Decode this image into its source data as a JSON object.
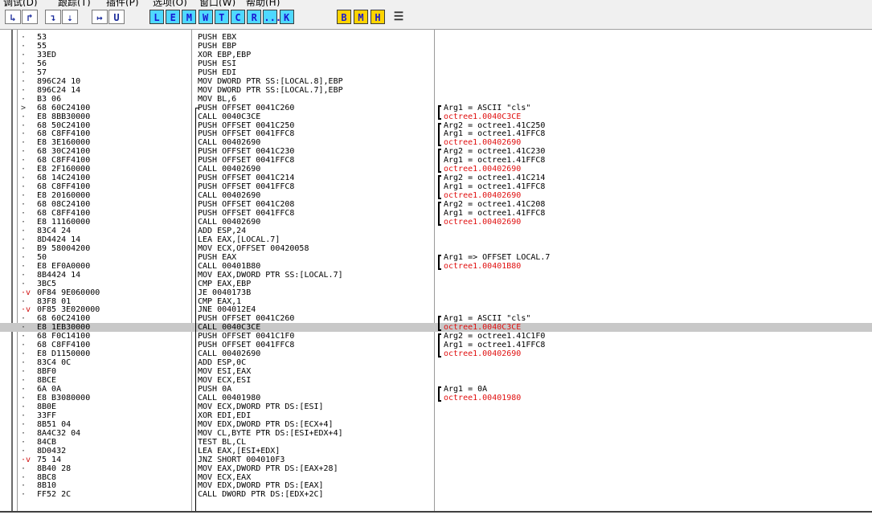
{
  "menubar": {
    "items": [
      "调试(D)",
      "跟踪(T)",
      "插件(P)",
      "选项(O)",
      "窗口(W)",
      "帮助(H)"
    ]
  },
  "toolbar": {
    "step_buttons": [
      "step-into",
      "step-over",
      "trace-into",
      "trace-over",
      "execute-till-return",
      "execute-till-user-code"
    ],
    "step_glyphs": [
      "↳",
      "↱",
      "↴",
      "⇣",
      "↦",
      "U"
    ],
    "window_buttons": [
      "L",
      "E",
      "M",
      "W",
      "T",
      "C",
      "R",
      "...",
      "K"
    ],
    "bp_buttons": [
      "B",
      "M",
      "H"
    ],
    "list_icon": "list-icon",
    "accent_cyan": "#4fd8ff",
    "accent_yellow": "#ffd400"
  },
  "cpu": {
    "rows": [
      {
        "mark": "·",
        "hex": "53",
        "dis": "PUSH EBX",
        "cmt": ""
      },
      {
        "mark": "·",
        "hex": "55",
        "dis": "PUSH EBP",
        "cmt": ""
      },
      {
        "mark": "·",
        "hex": "33ED",
        "dis": "XOR EBP,EBP",
        "cmt": ""
      },
      {
        "mark": "·",
        "hex": "56",
        "dis": "PUSH ESI",
        "cmt": ""
      },
      {
        "mark": "·",
        "hex": "57",
        "dis": "PUSH EDI",
        "cmt": ""
      },
      {
        "mark": "·",
        "hex": "896C24 10",
        "dis": "MOV DWORD PTR SS:[LOCAL.8],EBP",
        "cmt": ""
      },
      {
        "mark": "·",
        "hex": "896C24 14",
        "dis": "MOV DWORD PTR SS:[LOCAL.7],EBP",
        "cmt": ""
      },
      {
        "mark": "·",
        "hex": "B3 06",
        "dis": "MOV BL,6",
        "cmt": ""
      },
      {
        "mark": ">",
        "hex": "68 60C24100",
        "dis": "PUSH OFFSET 0041C260",
        "cmt": "Arg1 = ASCII \"cls\""
      },
      {
        "mark": "·",
        "hex": "E8 8BB30000",
        "dis": "CALL 0040C3CE",
        "cmt": "octree1.0040C3CE",
        "red": true
      },
      {
        "mark": "·",
        "hex": "68 50C24100",
        "dis": "PUSH OFFSET 0041C250",
        "cmt": "Arg2 = octree1.41C250"
      },
      {
        "mark": "·",
        "hex": "68 C8FF4100",
        "dis": "PUSH OFFSET 0041FFC8",
        "cmt": "Arg1 = octree1.41FFC8"
      },
      {
        "mark": "·",
        "hex": "E8 3E160000",
        "dis": "CALL 00402690",
        "cmt": "octree1.00402690",
        "red": true
      },
      {
        "mark": "·",
        "hex": "68 30C24100",
        "dis": "PUSH OFFSET 0041C230",
        "cmt": "Arg2 = octree1.41C230"
      },
      {
        "mark": "·",
        "hex": "68 C8FF4100",
        "dis": "PUSH OFFSET 0041FFC8",
        "cmt": "Arg1 = octree1.41FFC8"
      },
      {
        "mark": "·",
        "hex": "E8 2F160000",
        "dis": "CALL 00402690",
        "cmt": "octree1.00402690",
        "red": true
      },
      {
        "mark": "·",
        "hex": "68 14C24100",
        "dis": "PUSH OFFSET 0041C214",
        "cmt": "Arg2 = octree1.41C214"
      },
      {
        "mark": "·",
        "hex": "68 C8FF4100",
        "dis": "PUSH OFFSET 0041FFC8",
        "cmt": "Arg1 = octree1.41FFC8"
      },
      {
        "mark": "·",
        "hex": "E8 20160000",
        "dis": "CALL 00402690",
        "cmt": "octree1.00402690",
        "red": true
      },
      {
        "mark": "·",
        "hex": "68 08C24100",
        "dis": "PUSH OFFSET 0041C208",
        "cmt": "Arg2 = octree1.41C208"
      },
      {
        "mark": "·",
        "hex": "68 C8FF4100",
        "dis": "PUSH OFFSET 0041FFC8",
        "cmt": "Arg1 = octree1.41FFC8"
      },
      {
        "mark": "·",
        "hex": "E8 11160000",
        "dis": "CALL 00402690",
        "cmt": "octree1.00402690",
        "red": true
      },
      {
        "mark": "·",
        "hex": "83C4 24",
        "dis": "ADD ESP,24",
        "cmt": ""
      },
      {
        "mark": "·",
        "hex": "8D4424 14",
        "dis": "LEA EAX,[LOCAL.7]",
        "cmt": ""
      },
      {
        "mark": "·",
        "hex": "B9 58004200",
        "dis": "MOV ECX,OFFSET 00420058",
        "cmt": ""
      },
      {
        "mark": "·",
        "hex": "50",
        "dis": "PUSH EAX",
        "cmt": "Arg1 => OFFSET LOCAL.7"
      },
      {
        "mark": "·",
        "hex": "E8 EF0A0000",
        "dis": "CALL 00401B80",
        "cmt": "octree1.00401B80",
        "red": true
      },
      {
        "mark": "·",
        "hex": "8B4424 14",
        "dis": "MOV EAX,DWORD PTR SS:[LOCAL.7]",
        "cmt": ""
      },
      {
        "mark": "·",
        "hex": "3BC5",
        "dis": "CMP EAX,EBP",
        "cmt": ""
      },
      {
        "mark": "·v",
        "hex": "0F84 9E060000",
        "dis": "JE 0040173B",
        "cmt": "",
        "jmp": true
      },
      {
        "mark": "·",
        "hex": "83F8 01",
        "dis": "CMP EAX,1",
        "cmt": ""
      },
      {
        "mark": "·v",
        "hex": "0F85 3E020000",
        "dis": "JNE 004012E4",
        "cmt": "",
        "jmp": true
      },
      {
        "mark": "·",
        "hex": "68 60C24100",
        "dis": "PUSH OFFSET 0041C260",
        "cmt": "Arg1 = ASCII \"cls\""
      },
      {
        "mark": "·",
        "hex": "E8 1EB30000",
        "dis": "CALL 0040C3CE",
        "cmt": "octree1.0040C3CE",
        "red": true,
        "sel": true
      },
      {
        "mark": "·",
        "hex": "68 F0C14100",
        "dis": "PUSH OFFSET 0041C1F0",
        "cmt": "Arg2 = octree1.41C1F0"
      },
      {
        "mark": "·",
        "hex": "68 C8FF4100",
        "dis": "PUSH OFFSET 0041FFC8",
        "cmt": "Arg1 = octree1.41FFC8"
      },
      {
        "mark": "·",
        "hex": "E8 D1150000",
        "dis": "CALL 00402690",
        "cmt": "octree1.00402690",
        "red": true
      },
      {
        "mark": "·",
        "hex": "83C4 0C",
        "dis": "ADD ESP,0C",
        "cmt": ""
      },
      {
        "mark": "·",
        "hex": "8BF0",
        "dis": "MOV ESI,EAX",
        "cmt": ""
      },
      {
        "mark": "·",
        "hex": "8BCE",
        "dis": "MOV ECX,ESI",
        "cmt": ""
      },
      {
        "mark": "·",
        "hex": "6A 0A",
        "dis": "PUSH 0A",
        "cmt": "Arg1 = 0A"
      },
      {
        "mark": "·",
        "hex": "E8 B3080000",
        "dis": "CALL 00401980",
        "cmt": "octree1.00401980",
        "red": true
      },
      {
        "mark": "·",
        "hex": "8B0E",
        "dis": "MOV ECX,DWORD PTR DS:[ESI]",
        "cmt": ""
      },
      {
        "mark": "·",
        "hex": "33FF",
        "dis": "XOR EDI,EDI",
        "cmt": ""
      },
      {
        "mark": "·",
        "hex": "8B51 04",
        "dis": "MOV EDX,DWORD PTR DS:[ECX+4]",
        "cmt": ""
      },
      {
        "mark": "·",
        "hex": "8A4C32 04",
        "dis": "MOV CL,BYTE PTR DS:[ESI+EDX+4]",
        "cmt": ""
      },
      {
        "mark": "·",
        "hex": "84CB",
        "dis": "TEST BL,CL",
        "cmt": ""
      },
      {
        "mark": "·",
        "hex": "8D0432",
        "dis": "LEA EAX,[ESI+EDX]",
        "cmt": ""
      },
      {
        "mark": "·v",
        "hex": "75 14",
        "dis": "JNZ SHORT 004010F3",
        "cmt": "",
        "jmp": true
      },
      {
        "mark": "·",
        "hex": "8B40 28",
        "dis": "MOV EAX,DWORD PTR DS:[EAX+28]",
        "cmt": ""
      },
      {
        "mark": "·",
        "hex": "8BC8",
        "dis": "MOV ECX,EAX",
        "cmt": ""
      },
      {
        "mark": "·",
        "hex": "8B10",
        "dis": "MOV EDX,DWORD PTR DS:[EAX]",
        "cmt": ""
      },
      {
        "mark": "·",
        "hex": "FF52 2C",
        "dis": "CALL DWORD PTR DS:[EDX+2C]",
        "cmt": ""
      }
    ]
  }
}
